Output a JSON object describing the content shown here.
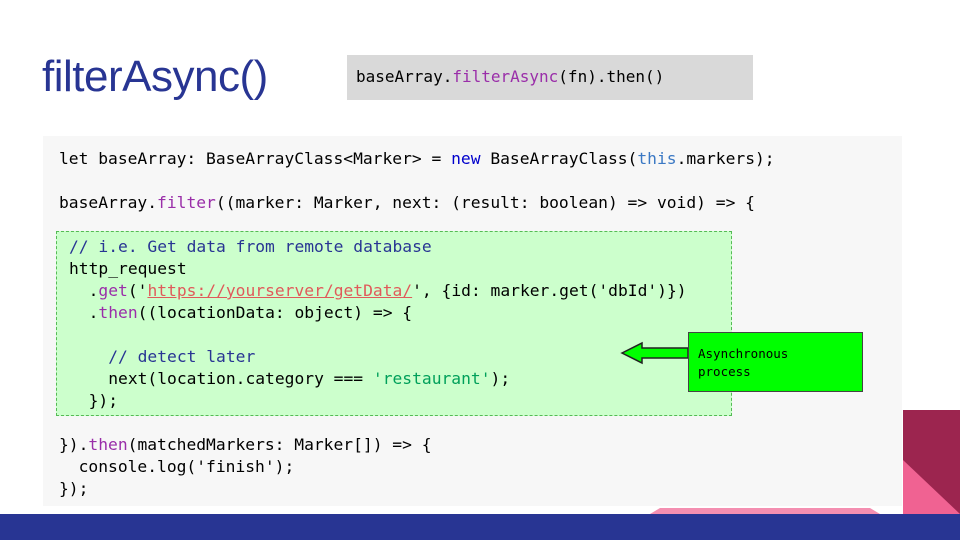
{
  "slide": {
    "title": "filterAsync()",
    "header_code": {
      "before": "baseArray.",
      "method": "filterAsync",
      "after": "(fn).then()"
    },
    "code": {
      "line1": {
        "a": "let baseArray: BaseArrayClass<Marker> = ",
        "new": "new",
        "b": " BaseArrayClass(",
        "this": "this",
        "c": ".markers);"
      },
      "line2": {
        "a": "baseArray.",
        "filter": "filter",
        "b": "((marker: Marker, next: (result: boolean) => void) => {"
      },
      "async_block": {
        "comment1": "// i.e. Get data from remote database",
        "http": "http_request",
        "get_prefix": "  .",
        "get": "get",
        "get_open": "('",
        "url": "https://yourserver/getData/",
        "get_rest": "', {id: marker.get('dbId')})",
        "then_prefix": "  .",
        "then": "then",
        "then_rest": "((locationData: object) => {",
        "comment2": "// detect later",
        "next_a": "next(location.category === ",
        "next_str": "'restaurant'",
        "next_b": ");",
        "close": "});"
      },
      "line_then": {
        "a": "}).",
        "then": "then",
        "b": "(matchedMarkers: Marker[]) => {"
      },
      "line_log": "  console.log('finish');",
      "line_end": "});"
    },
    "callout": {
      "line1": "Asynchronous",
      "line2": "process"
    },
    "colors": {
      "title": "#283593",
      "callout_bg": "#00ff00",
      "async_bg": "#ccffcc",
      "keyword_purple": "#9a2ea9",
      "footer_navy": "#283593",
      "accent_pink": "#f06292",
      "accent_maroon": "#9c254f"
    },
    "icons": [
      "left-arrow-icon"
    ]
  }
}
